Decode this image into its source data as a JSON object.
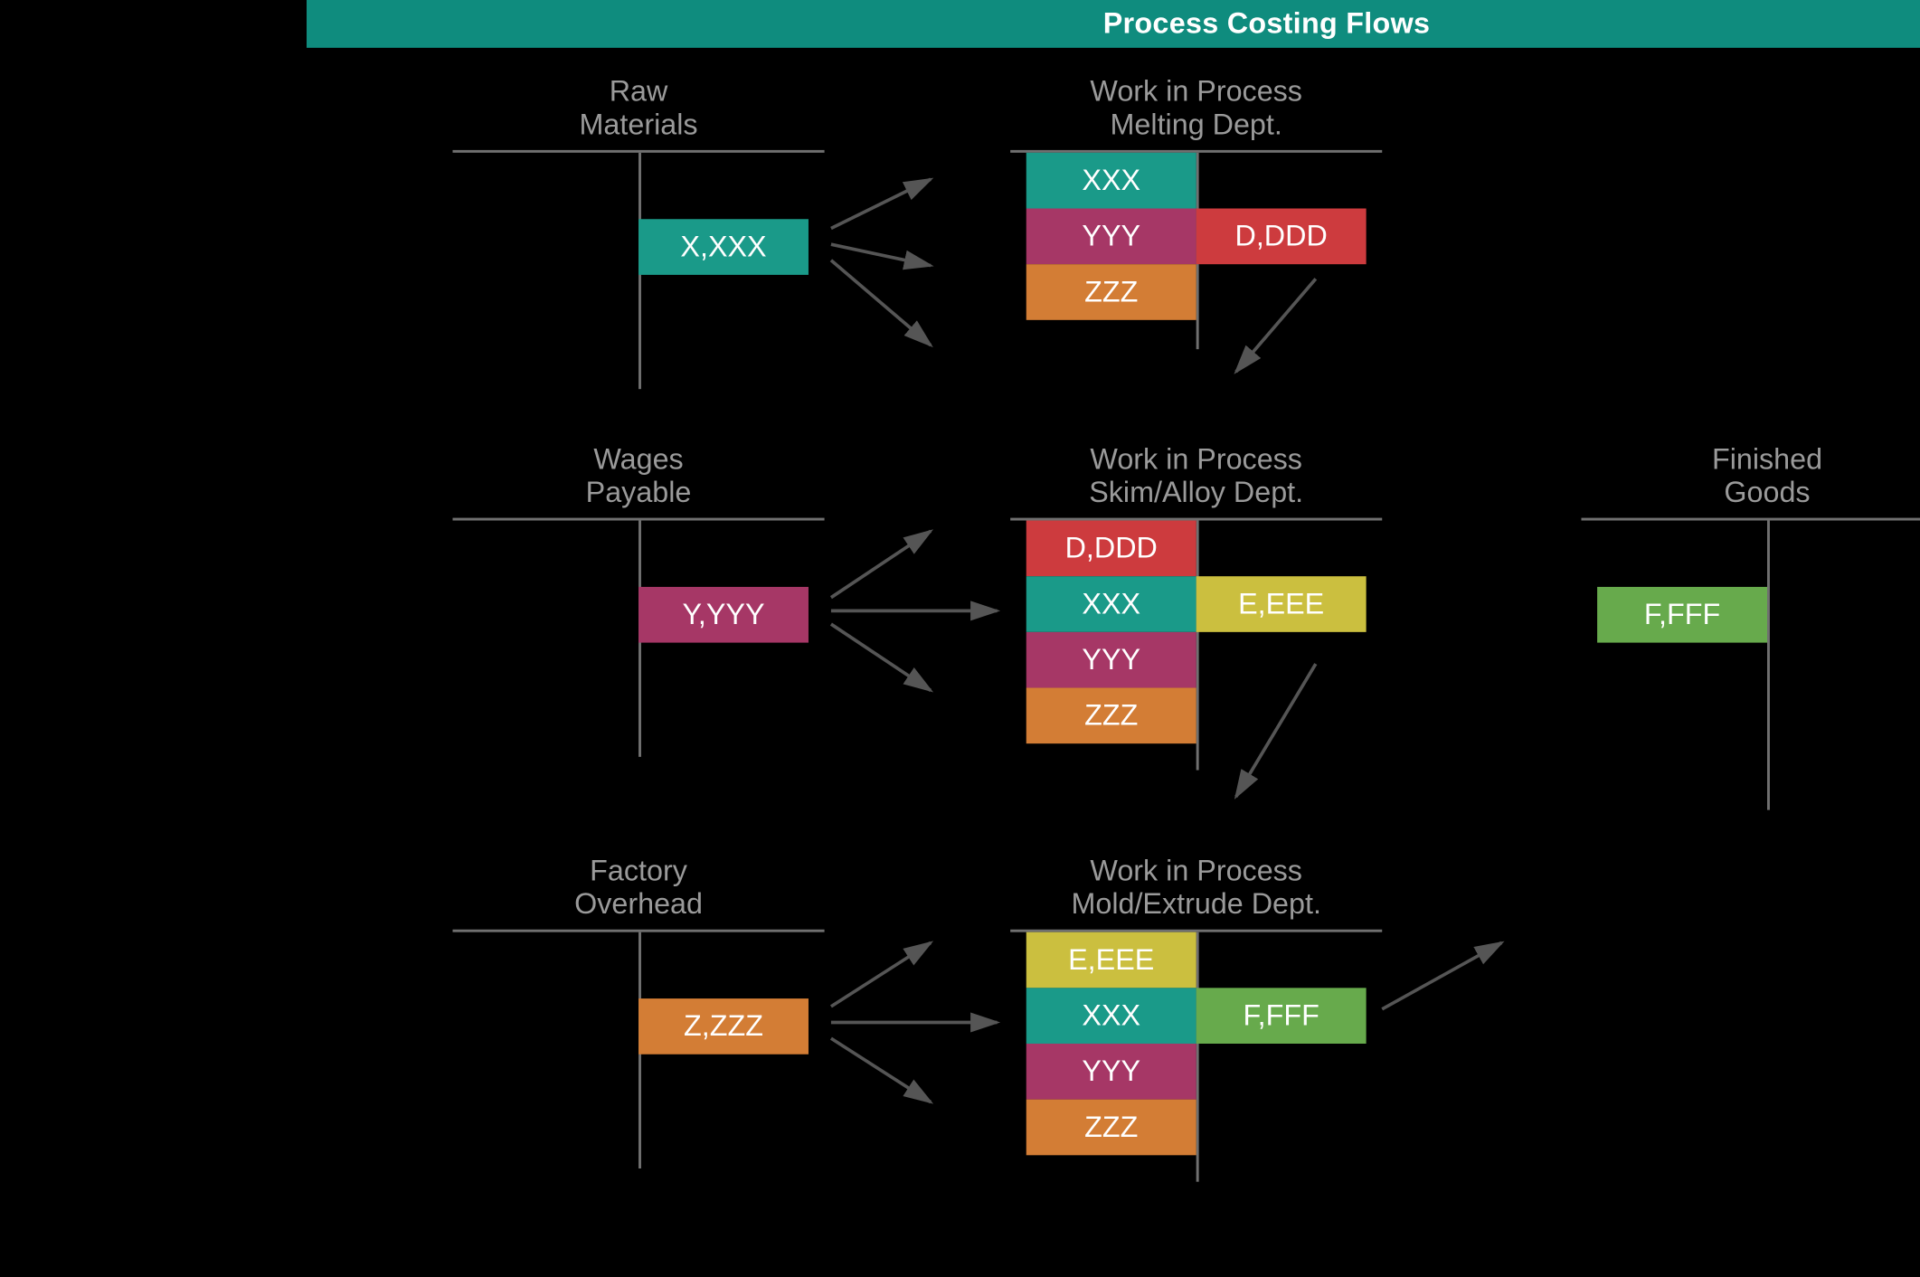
{
  "title": "Process Costing Flows",
  "colors": {
    "teal": "#1a9a89",
    "magenta": "#a63766",
    "orange": "#d37d35",
    "red": "#cd3b3e",
    "yellow": "#cbbf3f",
    "green": "#67aa4c",
    "banner": "#0f8c7e"
  },
  "accounts": {
    "raw_materials": {
      "title_l1": "Raw",
      "title_l2": "Materials",
      "credit": "X,XXX"
    },
    "wages_payable": {
      "title_l1": "Wages",
      "title_l2": "Payable",
      "credit": "Y,YYY"
    },
    "factory_overhead": {
      "title_l1": "Factory",
      "title_l2": "Overhead",
      "credit": "Z,ZZZ"
    },
    "wip_melting": {
      "title_l1": "Work in Process",
      "title_l2": "Melting Dept.",
      "debits": [
        "XXX",
        "YYY",
        "ZZZ"
      ],
      "credit": "D,DDD"
    },
    "wip_skim": {
      "title_l1": "Work in Process",
      "title_l2": "Skim/Alloy Dept.",
      "debits": [
        "D,DDD",
        "XXX",
        "YYY",
        "ZZZ"
      ],
      "credit": "E,EEE"
    },
    "wip_mold": {
      "title_l1": "Work in Process",
      "title_l2": "Mold/Extrude Dept.",
      "debits": [
        "E,EEE",
        "XXX",
        "YYY",
        "ZZZ"
      ],
      "credit": "F,FFF"
    },
    "finished_goods": {
      "title_l1": "Finished",
      "title_l2": "Goods",
      "debit": "F,FFF"
    }
  }
}
